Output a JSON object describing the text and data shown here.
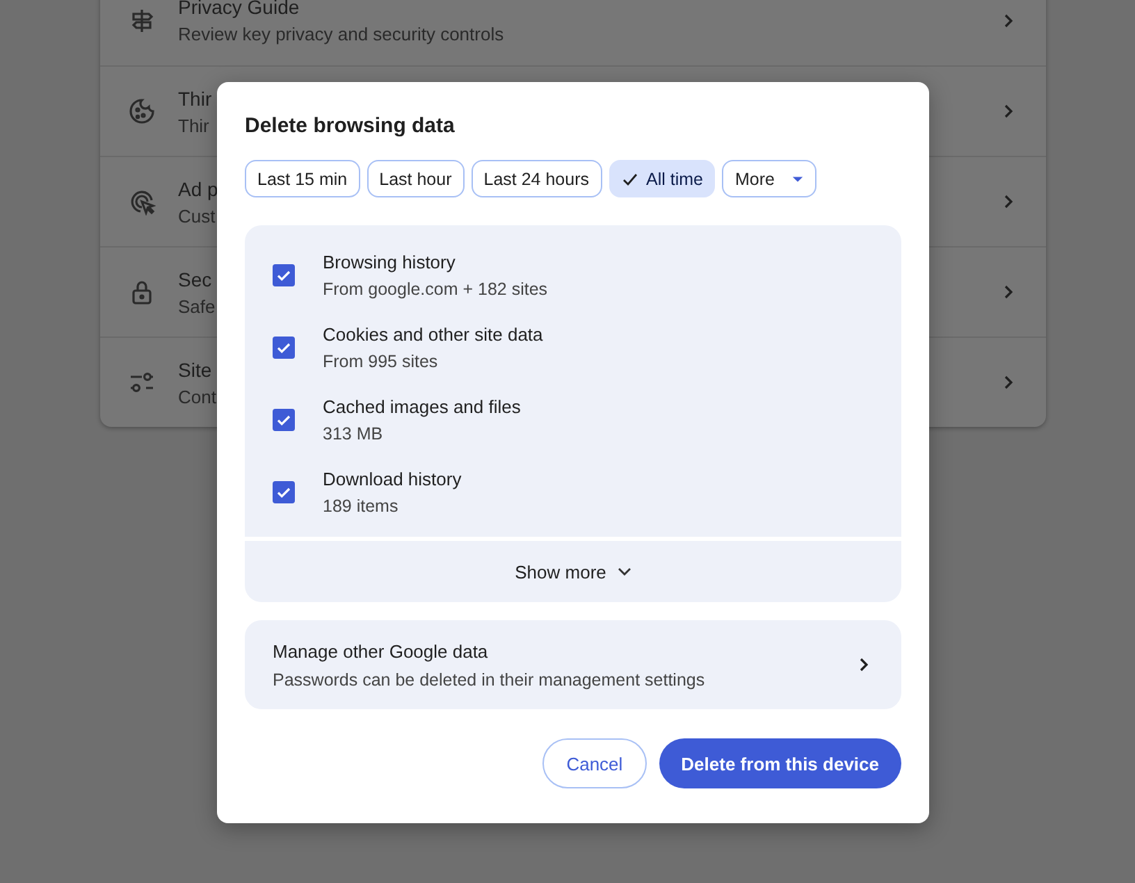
{
  "background_settings": {
    "rows": [
      {
        "title": "Privacy Guide",
        "subtitle": "Review key privacy and security controls"
      },
      {
        "title": "Thir",
        "subtitle": "Thir"
      },
      {
        "title": "Ad p",
        "subtitle": "Cust"
      },
      {
        "title": "Sec",
        "subtitle": "Safe"
      },
      {
        "title": "Site",
        "subtitle": "Cont"
      }
    ]
  },
  "dialog": {
    "title": "Delete browsing data",
    "time_ranges": [
      {
        "label": "Last 15 min",
        "kind": "chip",
        "selected": false
      },
      {
        "label": "Last hour",
        "kind": "chip",
        "selected": false
      },
      {
        "label": "Last 24 hours",
        "kind": "chip",
        "selected": false
      },
      {
        "label": "All time",
        "kind": "chip",
        "selected": true
      },
      {
        "label": "More",
        "kind": "dropdown",
        "selected": false
      }
    ],
    "data_types": [
      {
        "label": "Browsing history",
        "detail": "From google.com + 182 sites",
        "checked": true
      },
      {
        "label": "Cookies and other site data",
        "detail": "From 995 sites",
        "checked": true
      },
      {
        "label": "Cached images and files",
        "detail": "313 MB",
        "checked": true
      },
      {
        "label": "Download history",
        "detail": "189 items",
        "checked": true
      }
    ],
    "show_more": "Show more",
    "manage": {
      "title": "Manage other Google data",
      "subtitle": "Passwords can be deleted in their management settings"
    },
    "buttons": [
      {
        "label": "Cancel",
        "kind": "secondary"
      },
      {
        "label": "Delete from this device",
        "kind": "primary"
      }
    ]
  }
}
